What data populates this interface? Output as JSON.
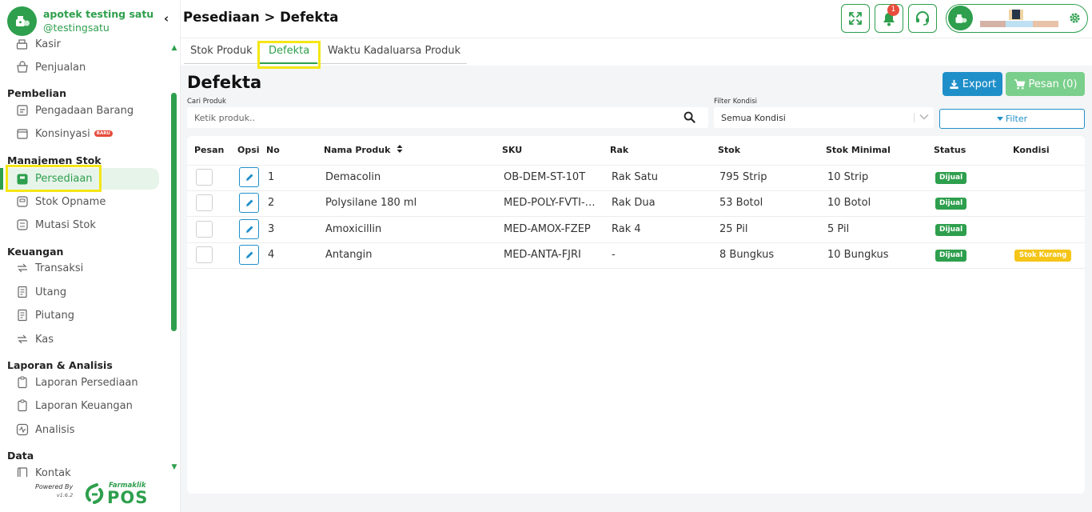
{
  "sidebar": {
    "brand_name": "apotek testing satu",
    "brand_handle": "@testingsatu",
    "items": [
      {
        "label": "Kasir",
        "icon": "register-icon"
      },
      {
        "label": "Penjualan",
        "icon": "basket-icon"
      },
      {
        "label": "Pengadaan Barang",
        "icon": "procurement-icon"
      },
      {
        "label": "Konsinyasi",
        "icon": "consignment-icon",
        "badge": "BARU"
      },
      {
        "label": "Persediaan",
        "icon": "inventory-icon",
        "active": true
      },
      {
        "label": "Stok Opname",
        "icon": "stock-opname-icon"
      },
      {
        "label": "Mutasi Stok",
        "icon": "stock-transfer-icon"
      },
      {
        "label": "Transaksi",
        "icon": "transfer-icon"
      },
      {
        "label": "Utang",
        "icon": "document-icon"
      },
      {
        "label": "Piutang",
        "icon": "document-icon"
      },
      {
        "label": "Kas",
        "icon": "transfer-icon"
      },
      {
        "label": "Laporan Persediaan",
        "icon": "clipboard-icon"
      },
      {
        "label": "Laporan Keuangan",
        "icon": "clipboard-icon"
      },
      {
        "label": "Analisis",
        "icon": "pulse-icon"
      },
      {
        "label": "Kontak",
        "icon": "contact-icon"
      }
    ],
    "sections": {
      "pembelian": "Pembelian",
      "manajemen_stok": "Manajemen Stok",
      "keuangan": "Keuangan",
      "laporan": "Laporan & Analisis",
      "data": "Data"
    },
    "powered_by": "Powered By",
    "version": "v1.6.2",
    "footer_brand": "Farmaklik",
    "footer_product": "POS"
  },
  "header": {
    "breadcrumb": "Pesediaan > Defekta",
    "notification_count": "1"
  },
  "tabs": [
    "Stok Produk",
    "Defekta",
    "Waktu Kadaluarsa Produk"
  ],
  "main": {
    "title": "Defekta",
    "export_label": "Export",
    "pesan_label": "Pesan (0)",
    "search_label": "Cari Produk",
    "search_placeholder": "Ketik produk..",
    "filter_label": "Filter Kondisi",
    "filter_value": "Semua Kondisi",
    "filter_button": "Filter"
  },
  "table": {
    "columns": [
      "Pesan",
      "Opsi",
      "No",
      "Nama Produk",
      "SKU",
      "Rak",
      "Stok",
      "Stok Minimal",
      "Status",
      "Kondisi"
    ],
    "rows": [
      {
        "no": "1",
        "name": "Demacolin",
        "sku": "OB-DEM-ST-10T",
        "rak": "Rak Satu",
        "stok": "795 Strip",
        "stok_min": "10 Strip",
        "status": "Dijual",
        "kondisi": ""
      },
      {
        "no": "2",
        "name": "Polysilane 180 ml",
        "sku": "MED-POLY-FVTI-…",
        "rak": "Rak Dua",
        "stok": "53 Botol",
        "stok_min": "10 Botol",
        "status": "Dijual",
        "kondisi": ""
      },
      {
        "no": "3",
        "name": "Amoxicillin",
        "sku": "MED-AMOX-FZEP",
        "rak": "Rak 4",
        "stok": "25 Pil",
        "stok_min": "5 Pil",
        "status": "Dijual",
        "kondisi": ""
      },
      {
        "no": "4",
        "name": "Antangin",
        "sku": "MED-ANTA-FJRI",
        "rak": "-",
        "stok": "8 Bungkus",
        "stok_min": "10 Bungkus",
        "status": "Dijual",
        "kondisi": "Stok Kurang"
      }
    ]
  },
  "colors": {
    "primary_green": "#2e9f4d",
    "accent_blue": "#1f8fc9",
    "warning_yellow": "#f5c518",
    "highlight": "#f5e614"
  }
}
